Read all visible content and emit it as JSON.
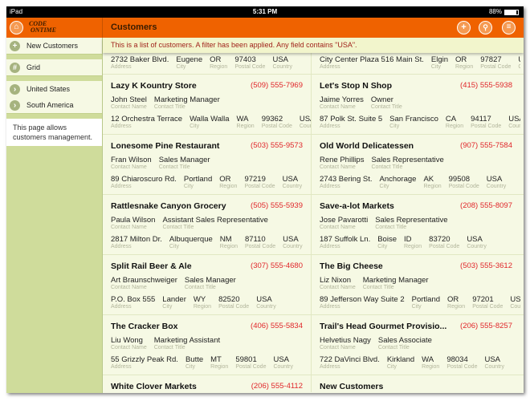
{
  "status_bar": {
    "device": "iPad",
    "time": "5:31 PM",
    "battery": "88%",
    "battery_level": 0.88
  },
  "header": {
    "title": "Customers",
    "logo": "CODE ON TIME",
    "buttons": [
      {
        "name": "add",
        "icon": "plus-icon"
      },
      {
        "name": "search",
        "icon": "search-icon"
      },
      {
        "name": "menu",
        "icon": "menu-icon"
      }
    ]
  },
  "sidebar": {
    "actions": [
      {
        "label": "New Customers",
        "icon": "plus-icon"
      }
    ],
    "views": [
      {
        "label": "Grid",
        "icon": "grid-icon"
      }
    ],
    "filters": [
      {
        "label": "United States",
        "icon": "chevron-right-icon"
      },
      {
        "label": "South America",
        "icon": "chevron-right-icon"
      }
    ],
    "description": "This page allows customers management."
  },
  "banner": "This is a list of customers. A filter has been applied. Any field contains \"USA\".",
  "labels": {
    "contact_name": "Contact Name",
    "contact_title": "Contact Title",
    "address": "Address",
    "city": "City",
    "region": "Region",
    "postal_code": "Postal Code",
    "country": "Country"
  },
  "partial_row": [
    {
      "address": "2732 Baker Blvd.",
      "city": "Eugene",
      "region": "OR",
      "postal_code": "97403",
      "country": "USA"
    },
    {
      "address": "City Center Plaza 516 Main St.",
      "city": "Elgin",
      "region": "OR",
      "postal_code": "97827",
      "country": "USA"
    }
  ],
  "rows": [
    [
      {
        "company": "Lazy K Kountry Store",
        "phone": "(509) 555-7969",
        "contact": "John Steel",
        "title": "Marketing Manager",
        "address": "12 Orchestra Terrace",
        "city": "Walla Walla",
        "region": "WA",
        "postal_code": "99362",
        "country": "USA"
      },
      {
        "company": "Let's Stop N Shop",
        "phone": "(415) 555-5938",
        "contact": "Jaime Yorres",
        "title": "Owner",
        "address": "87 Polk St. Suite 5",
        "city": "San Francisco",
        "region": "CA",
        "postal_code": "94117",
        "country": "USA"
      }
    ],
    [
      {
        "company": "Lonesome Pine Restaurant",
        "phone": "(503) 555-9573",
        "contact": "Fran Wilson",
        "title": "Sales Manager",
        "address": "89 Chiaroscuro Rd.",
        "city": "Portland",
        "region": "OR",
        "postal_code": "97219",
        "country": "USA"
      },
      {
        "company": "Old World Delicatessen",
        "phone": "(907) 555-7584",
        "contact": "Rene Phillips",
        "title": "Sales Representative",
        "address": "2743 Bering St.",
        "city": "Anchorage",
        "region": "AK",
        "postal_code": "99508",
        "country": "USA"
      }
    ],
    [
      {
        "company": "Rattlesnake Canyon Grocery",
        "phone": "(505) 555-5939",
        "contact": "Paula Wilson",
        "title": "Assistant Sales Representative",
        "address": "2817 Milton Dr.",
        "city": "Albuquerque",
        "region": "NM",
        "postal_code": "87110",
        "country": "USA"
      },
      {
        "company": "Save-a-lot Markets",
        "phone": "(208) 555-8097",
        "contact": "Jose Pavarotti",
        "title": "Sales Representative",
        "address": "187 Suffolk Ln.",
        "city": "Boise",
        "region": "ID",
        "postal_code": "83720",
        "country": "USA"
      }
    ],
    [
      {
        "company": "Split Rail Beer & Ale",
        "phone": "(307) 555-4680",
        "contact": "Art Braunschweiger",
        "title": "Sales Manager",
        "address": "P.O. Box 555",
        "city": "Lander",
        "region": "WY",
        "postal_code": "82520",
        "country": "USA"
      },
      {
        "company": "The Big Cheese",
        "phone": "(503) 555-3612",
        "contact": "Liz Nixon",
        "title": "Marketing Manager",
        "address": "89 Jefferson Way Suite 2",
        "city": "Portland",
        "region": "OR",
        "postal_code": "97201",
        "country": "USA"
      }
    ],
    [
      {
        "company": "The Cracker Box",
        "phone": "(406) 555-5834",
        "contact": "Liu Wong",
        "title": "Marketing Assistant",
        "address": "55 Grizzly Peak Rd.",
        "city": "Butte",
        "region": "MT",
        "postal_code": "59801",
        "country": "USA"
      },
      {
        "company": "Trail's Head Gourmet Provisio...",
        "phone": "(206) 555-8257",
        "contact": "Helvetius Nagy",
        "title": "Sales Associate",
        "address": "722 DaVinci Blvd.",
        "city": "Kirkland",
        "region": "WA",
        "postal_code": "98034",
        "country": "USA"
      }
    ],
    [
      {
        "company": "White Clover Markets",
        "phone": "(206) 555-4112"
      },
      {
        "company": "New Customers"
      }
    ]
  ]
}
